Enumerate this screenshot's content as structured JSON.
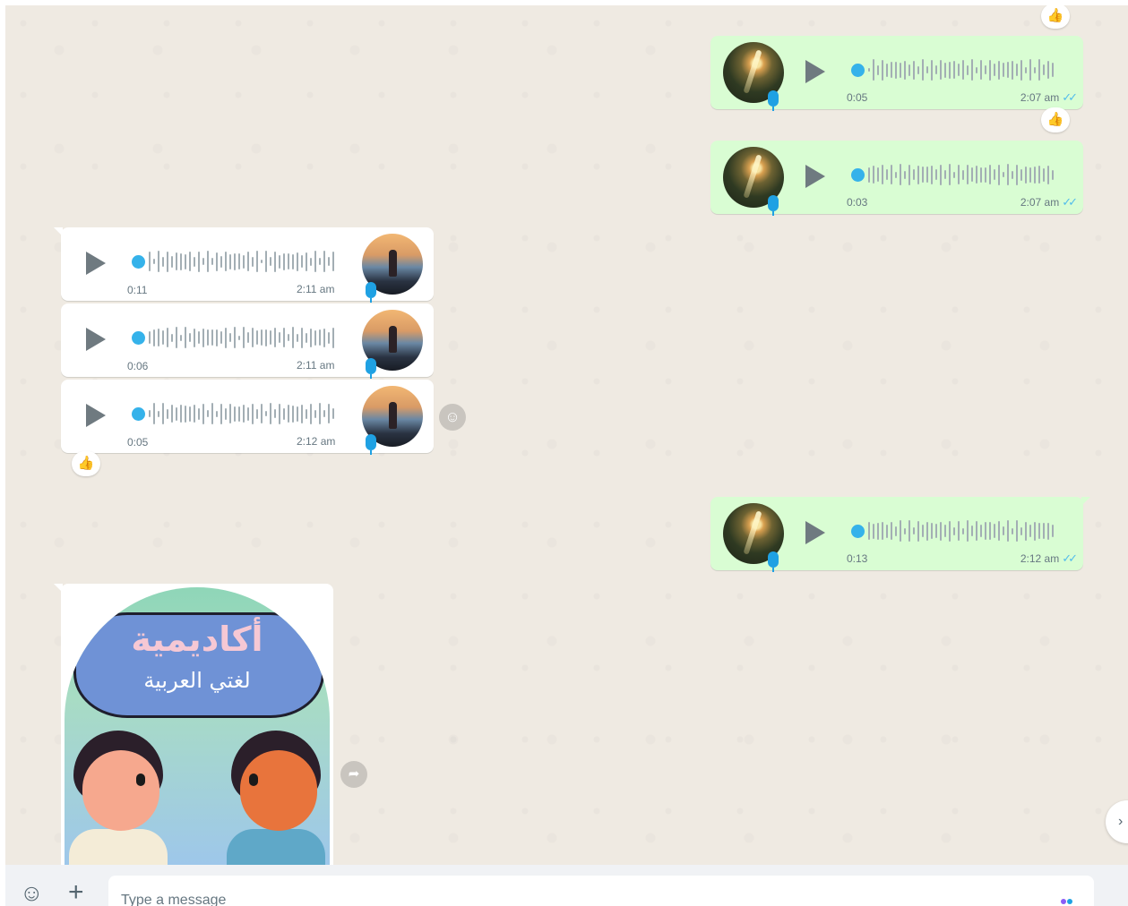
{
  "colors": {
    "outgoing_bubble": "#d9fdd3",
    "incoming_bubble": "#ffffff",
    "chat_background": "#efeae2",
    "read_ticks": "#53bdeb",
    "voice_dot": "#35b2ea"
  },
  "icons": {
    "reaction": "thumbs-up-icon",
    "reaction_glyph": "👍",
    "emoji_button": "smiley-icon",
    "emoji_glyph": "☺",
    "attach_button": "plus-icon",
    "attach_glyph": "+",
    "react_button": "smiley-icon",
    "forward_button": "forward-icon",
    "forward_glyph": "➦",
    "read_ticks_glyph": "✓✓",
    "scroll_down_glyph": "›"
  },
  "messages": [
    {
      "direction": "out",
      "duration": "0:05",
      "time": "2:07 am",
      "status": "read",
      "reaction": "👍"
    },
    {
      "direction": "out",
      "duration": "0:03",
      "time": "2:07 am",
      "status": "read",
      "reaction": "👍"
    },
    {
      "direction": "in",
      "duration": "0:11",
      "time": "2:11 am"
    },
    {
      "direction": "in",
      "duration": "0:06",
      "time": "2:11 am"
    },
    {
      "direction": "in",
      "duration": "0:05",
      "time": "2:12 am",
      "reaction": "👍"
    },
    {
      "direction": "out",
      "duration": "0:13",
      "time": "2:12 am",
      "status": "read"
    }
  ],
  "image_message": {
    "title": "أكاديمية",
    "subtitle": "لغتي العربية"
  },
  "composer": {
    "placeholder": "Type a message"
  }
}
